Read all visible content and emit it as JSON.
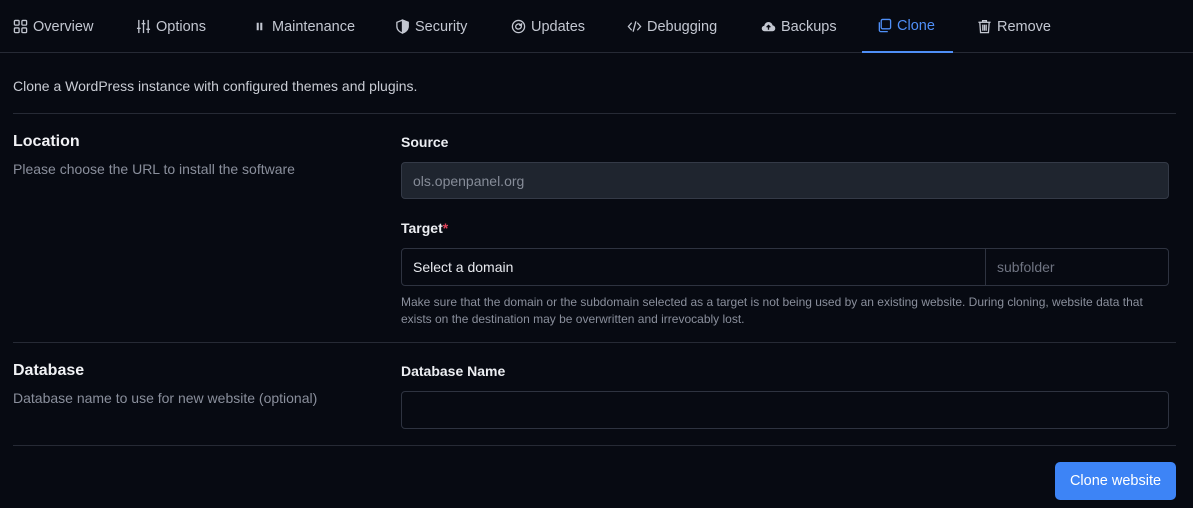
{
  "tabs": [
    {
      "label": "Overview",
      "icon": "grid-icon"
    },
    {
      "label": "Options",
      "icon": "sliders-icon"
    },
    {
      "label": "Maintenance",
      "icon": "pause-icon"
    },
    {
      "label": "Security",
      "icon": "shield-icon"
    },
    {
      "label": "Updates",
      "icon": "refresh-icon"
    },
    {
      "label": "Debugging",
      "icon": "code-icon"
    },
    {
      "label": "Backups",
      "icon": "cloud-upload-icon"
    },
    {
      "label": "Clone",
      "icon": "copy-icon",
      "active": true
    },
    {
      "label": "Remove",
      "icon": "trash-icon"
    }
  ],
  "intro": "Clone a WordPress instance with configured themes and plugins.",
  "location": {
    "title": "Location",
    "description": "Please choose the URL to install the software",
    "source_label": "Source",
    "source_value": "ols.openpanel.org",
    "target_label": "Target",
    "target_required": "*",
    "domain_select": "Select a domain",
    "subfolder_placeholder": "subfolder",
    "hint": "Make sure that the domain or the subdomain selected as a target is not being used by an existing website. During cloning, website data that exists on the destination may be overwritten and irrevocably lost."
  },
  "database": {
    "title": "Database",
    "description": "Database name to use for new website (optional)",
    "name_label": "Database Name",
    "name_value": ""
  },
  "actions": {
    "clone_label": "Clone website"
  },
  "colors": {
    "accent": "#3d84f6",
    "background": "#070a12",
    "required": "#e0445b"
  }
}
